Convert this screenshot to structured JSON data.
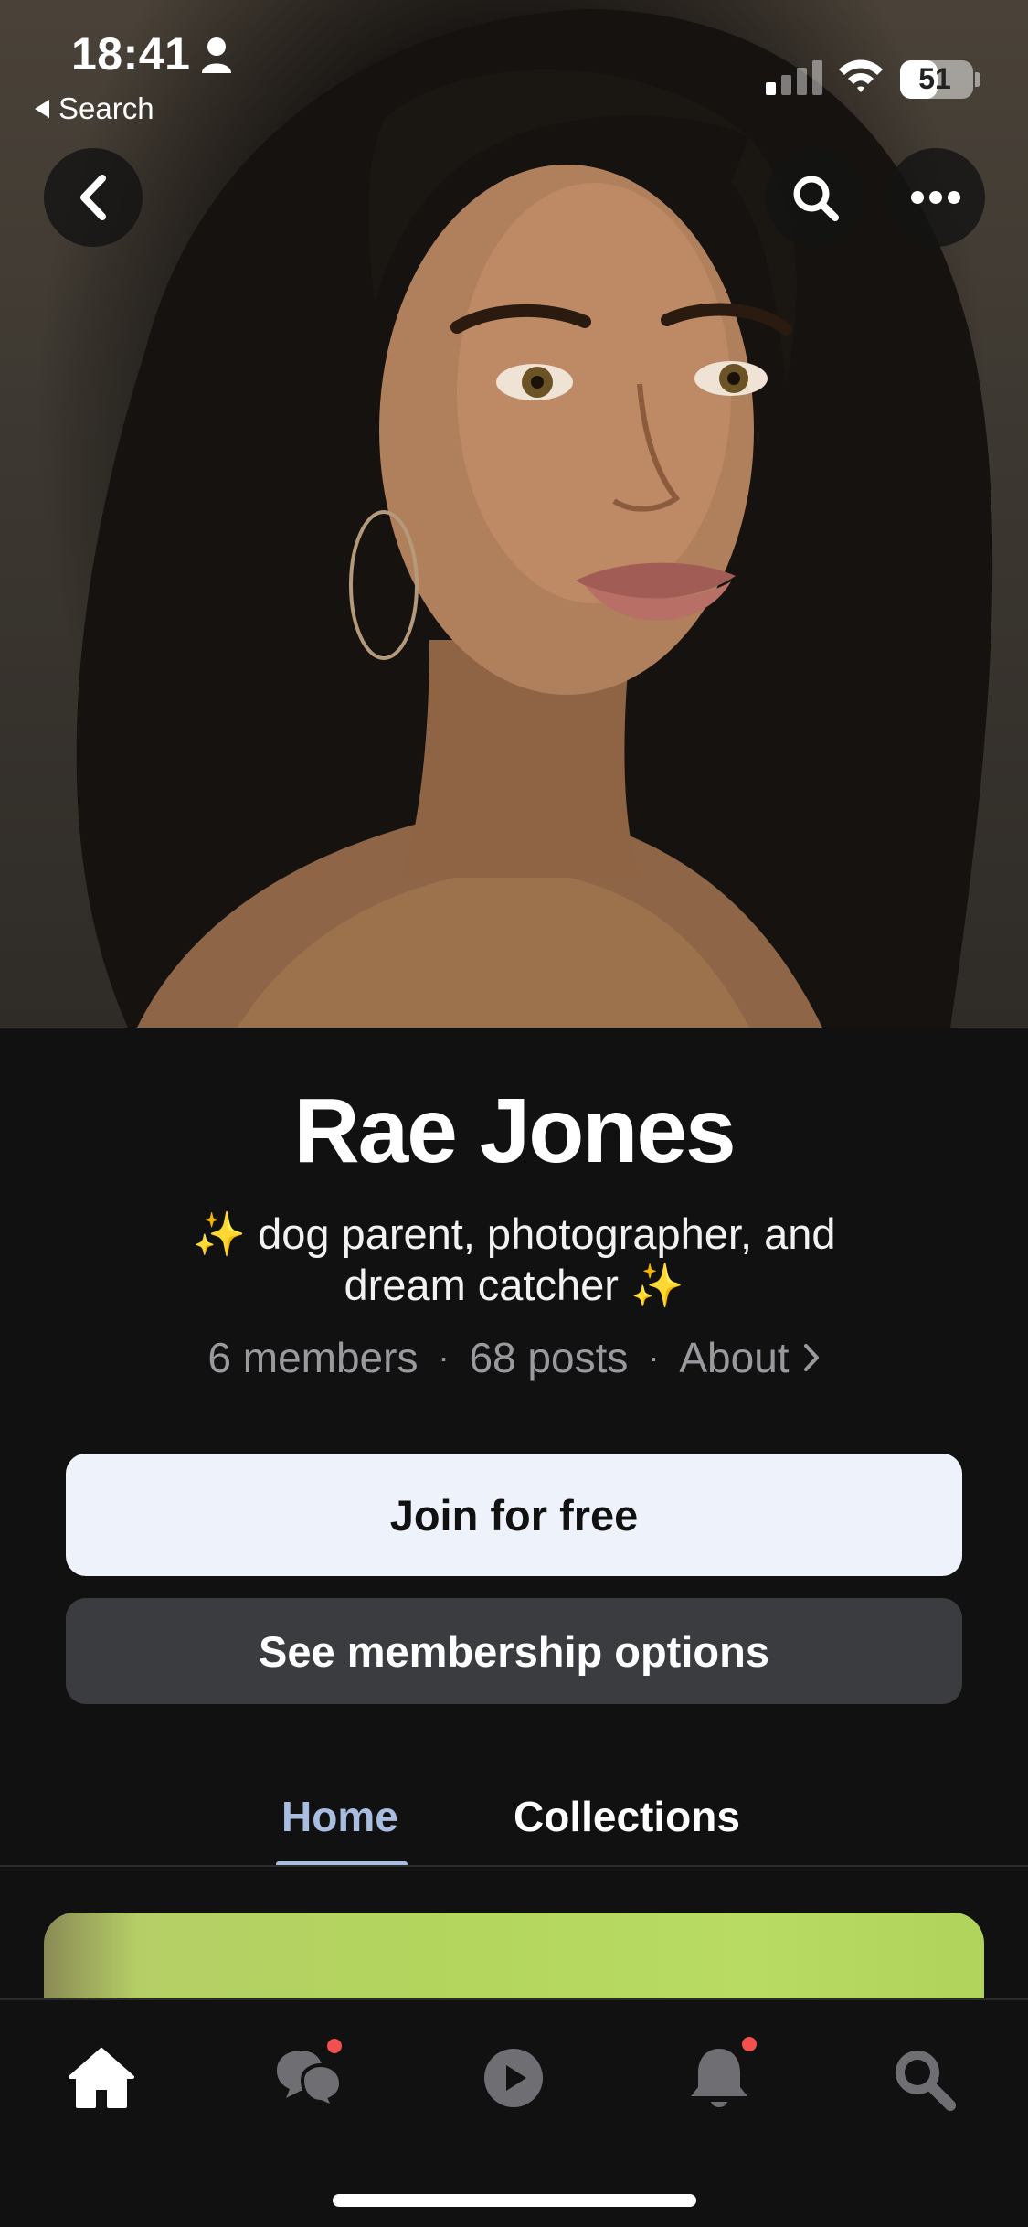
{
  "status_bar": {
    "time": "18:41",
    "back_app_label": "Search",
    "battery_level": "51",
    "signal_bars_active": 1,
    "signal_bars_total": 4
  },
  "header_actions": {
    "back_icon": "chevron-left-icon",
    "search_icon": "search-icon",
    "more_icon": "ellipsis-icon"
  },
  "profile": {
    "name": "Rae Jones",
    "bio": "✨ dog parent, photographer, and dream catcher ✨",
    "members": "6 members",
    "posts": "68 posts",
    "about": "About",
    "separator": "·"
  },
  "actions": {
    "join_label": "Join for free",
    "membership_label": "See membership options"
  },
  "tabs": [
    {
      "label": "Home",
      "active": true
    },
    {
      "label": "Collections",
      "active": false
    }
  ],
  "tabbar": {
    "items": [
      {
        "icon": "home-icon",
        "active": true,
        "badge": false
      },
      {
        "icon": "chat-icon",
        "active": false,
        "badge": true
      },
      {
        "icon": "play-icon",
        "active": false,
        "badge": false
      },
      {
        "icon": "bell-icon",
        "active": false,
        "badge": true
      },
      {
        "icon": "search-icon",
        "active": false,
        "badge": false
      }
    ]
  },
  "colors": {
    "background": "#111112",
    "accent_tab": "#a9bde0",
    "join_button": "#edf2fb",
    "options_button": "#3b3c40",
    "badge": "#f0514f"
  }
}
